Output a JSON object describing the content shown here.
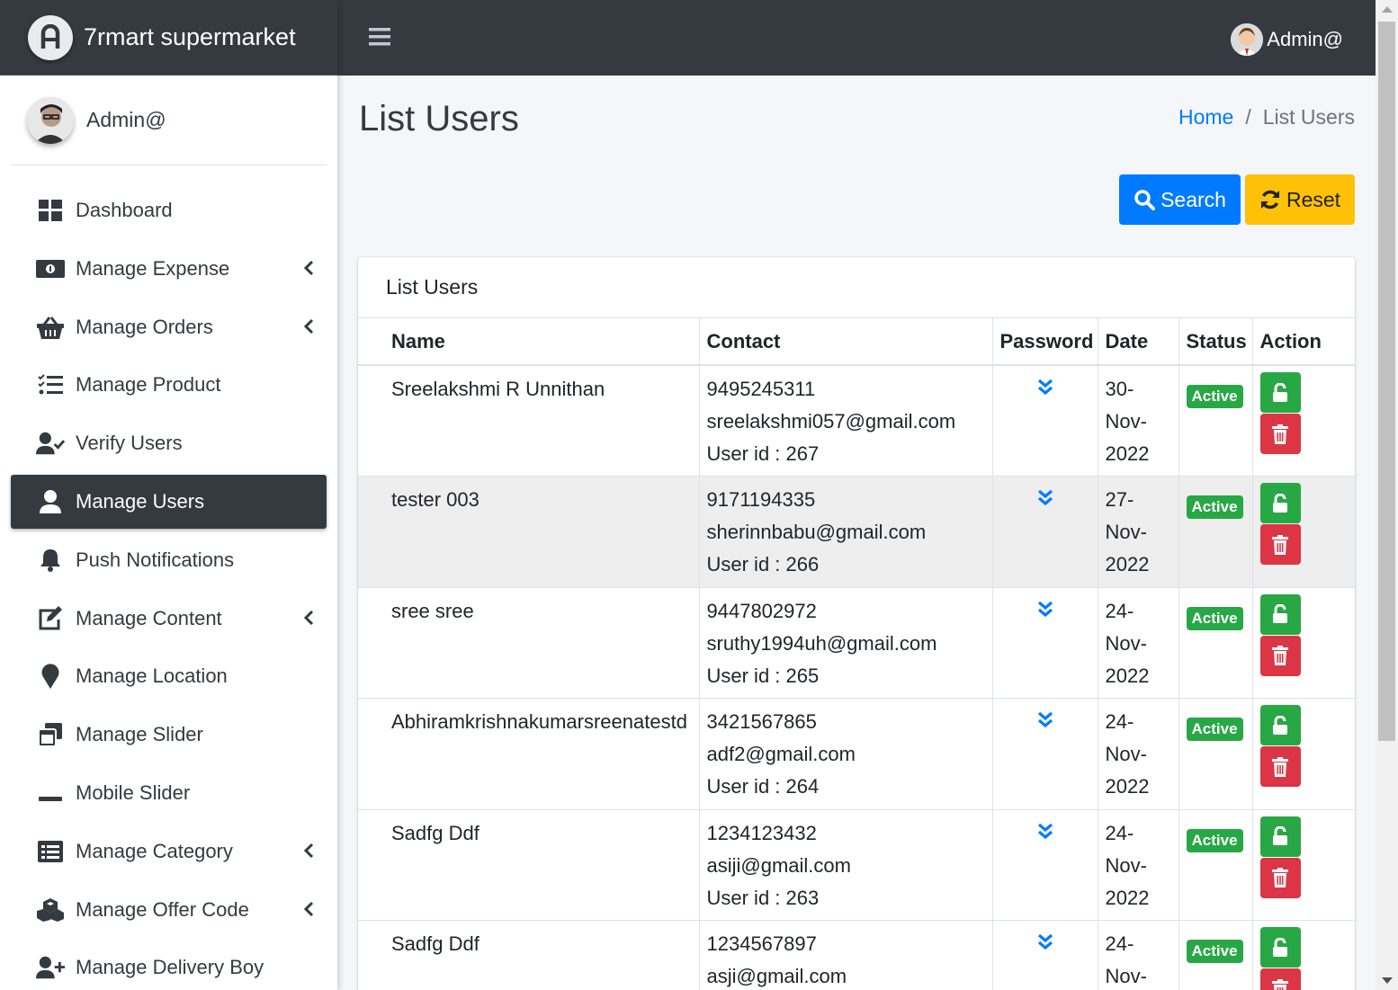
{
  "brand": {
    "name": "7rmart supermarket"
  },
  "user": {
    "name": "Admin@"
  },
  "topbar": {
    "user_name": "Admin@"
  },
  "sidebar": {
    "items": [
      {
        "label": "Dashboard",
        "icon": "dashboard-icon",
        "has_caret": false,
        "active": false
      },
      {
        "label": "Manage Expense",
        "icon": "money-bill-icon",
        "has_caret": true,
        "active": false
      },
      {
        "label": "Manage Orders",
        "icon": "basket-icon",
        "has_caret": true,
        "active": false
      },
      {
        "label": "Manage Product",
        "icon": "tasks-list-icon",
        "has_caret": false,
        "active": false
      },
      {
        "label": "Verify Users",
        "icon": "user-check-icon",
        "has_caret": false,
        "active": false
      },
      {
        "label": "Manage Users",
        "icon": "user-icon",
        "has_caret": false,
        "active": true
      },
      {
        "label": "Push Notifications",
        "icon": "bell-icon",
        "has_caret": false,
        "active": false
      },
      {
        "label": "Manage Content",
        "icon": "edit-icon",
        "has_caret": true,
        "active": false
      },
      {
        "label": "Manage Location",
        "icon": "map-marker-icon",
        "has_caret": false,
        "active": false
      },
      {
        "label": "Manage Slider",
        "icon": "window-restore-icon",
        "has_caret": false,
        "active": false
      },
      {
        "label": "Mobile Slider",
        "icon": "minus-icon",
        "has_caret": false,
        "active": false
      },
      {
        "label": "Manage Category",
        "icon": "list-alt-icon",
        "has_caret": true,
        "active": false
      },
      {
        "label": "Manage Offer Code",
        "icon": "cubes-icon",
        "has_caret": true,
        "active": false
      },
      {
        "label": "Manage Delivery Boy",
        "icon": "user-plus-icon",
        "has_caret": false,
        "active": false
      }
    ]
  },
  "page": {
    "title": "List Users",
    "breadcrumb": {
      "home": "Home",
      "separator": "/",
      "current": "List Users"
    }
  },
  "toolbar": {
    "search_label": "Search",
    "reset_label": "Reset"
  },
  "card": {
    "title": "List Users"
  },
  "table": {
    "headers": [
      "Name",
      "Contact",
      "Password",
      "Date",
      "Status",
      "Action"
    ],
    "rows": [
      {
        "name": "Sreelakshmi R Unnithan",
        "phone": "9495245311",
        "email": "sreelakshmi057@gmail.com",
        "user_id": "User id : 267",
        "date_a": "30-",
        "date_b": "Nov-",
        "date_c": "2022",
        "status": "Active"
      },
      {
        "name": "tester 003",
        "phone": "9171194335",
        "email": "sherinnbabu@gmail.com",
        "user_id": "User id : 266",
        "date_a": "27-",
        "date_b": "Nov-",
        "date_c": "2022",
        "status": "Active"
      },
      {
        "name": "sree sree",
        "phone": "9447802972",
        "email": "sruthy1994uh@gmail.com",
        "user_id": "User id : 265",
        "date_a": "24-",
        "date_b": "Nov-",
        "date_c": "2022",
        "status": "Active"
      },
      {
        "name": "Abhiramkrishnakumarsreenatestd",
        "phone": "3421567865",
        "email": "adf2@gmail.com",
        "user_id": "User id : 264",
        "date_a": "24-",
        "date_b": "Nov-",
        "date_c": "2022",
        "status": "Active"
      },
      {
        "name": "Sadfg Ddf",
        "phone": "1234123432",
        "email": "asiji@gmail.com",
        "user_id": "User id : 263",
        "date_a": "24-",
        "date_b": "Nov-",
        "date_c": "2022",
        "status": "Active"
      },
      {
        "name": "Sadfg Ddf",
        "phone": "1234567897",
        "email": "asji@gmail.com",
        "user_id": "",
        "date_a": "24-",
        "date_b": "Nov-",
        "date_c": "",
        "status": "Active"
      }
    ]
  },
  "colors": {
    "dark": "#343a40",
    "primary": "#007bff",
    "warning": "#ffc107",
    "success": "#28a745",
    "danger": "#dc3545"
  }
}
